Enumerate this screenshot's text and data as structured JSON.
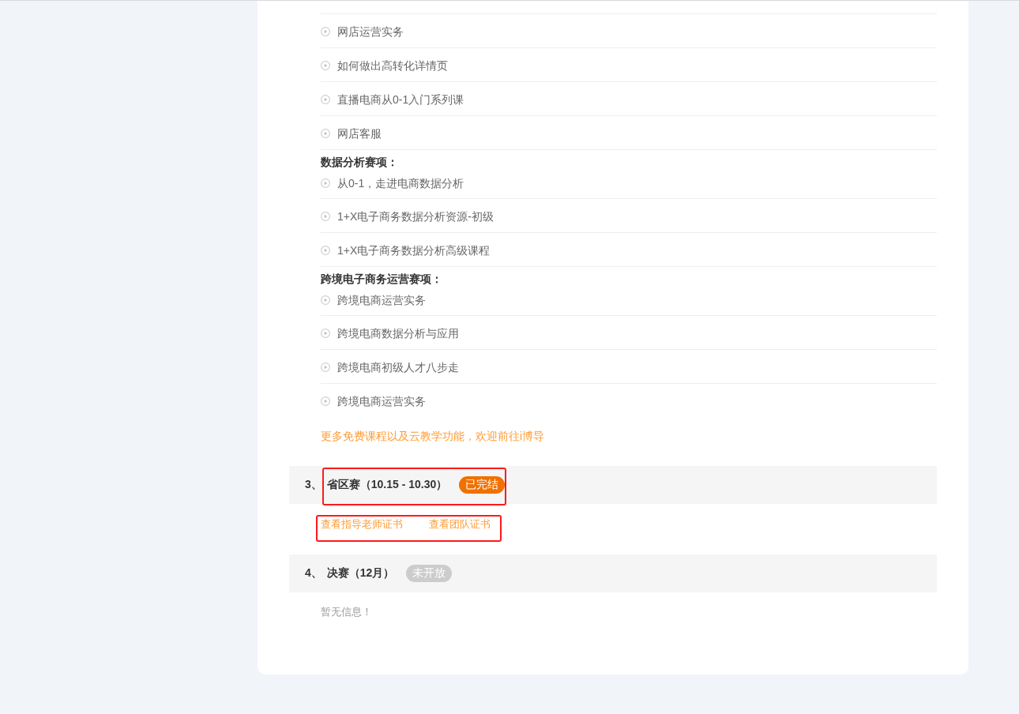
{
  "course_groups": [
    {
      "items": [
        "网店运营实务",
        "如何做出高转化详情页",
        "直播电商从0-1入门系列课",
        "网店客服"
      ]
    },
    {
      "title": "数据分析赛项：",
      "items": [
        "从0-1，走进电商数据分析",
        "1+X电子商务数据分析资源-初级",
        "1+X电子商务数据分析高级课程"
      ]
    },
    {
      "title": "跨境电子商务运营赛项：",
      "items": [
        "跨境电商运营实务",
        "跨境电商数据分析与应用",
        "跨境电商初级人才八步走",
        "跨境电商运营实务"
      ]
    }
  ],
  "more_link": "更多免费课程以及云教学功能，欢迎前往i博导",
  "stages": [
    {
      "number": "3、",
      "title": "省区赛（10.15 - 10.30）",
      "status": {
        "label": "已完结",
        "kind": "finished"
      },
      "highlighted": true,
      "links": [
        "查看指导老师证书",
        "查看团队证书"
      ],
      "links_highlighted": true
    },
    {
      "number": "4、",
      "title": "决赛（12月）",
      "status": {
        "label": "未开放",
        "kind": "closed"
      },
      "highlighted": false,
      "message": "暂无信息！"
    }
  ]
}
